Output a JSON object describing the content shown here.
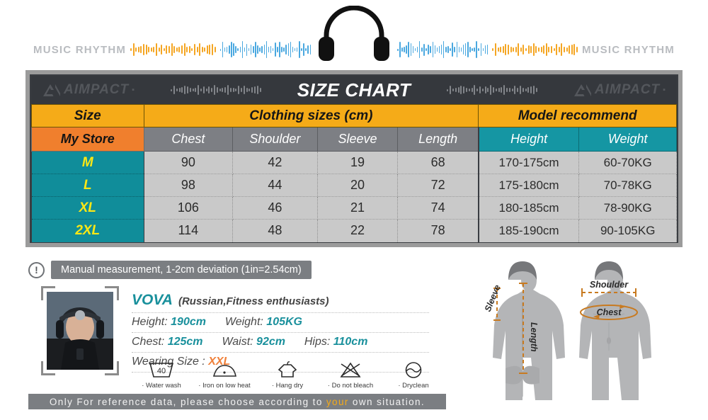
{
  "banner": {
    "left_text": "MUSIC RHYTHM",
    "right_text": "MUSIC RHYTHM",
    "headphone_icon": "headphones-icon",
    "wave_color_orange": "#f5a623",
    "wave_color_blue": "#4aa8e0"
  },
  "chart": {
    "title": "SIZE CHART",
    "brand_left": "AIMPACT",
    "brand_right": "AIMPACT",
    "brand_mark": "aimpact-logo-icon",
    "colors": {
      "gold": "#f5ab18",
      "orange": "#f07f2d",
      "teal": "#1596a3",
      "dark": "#35383d",
      "gray_value": "#c9c9c9",
      "size_label_yellow": "#ffe814"
    }
  },
  "chart_data": {
    "type": "table",
    "title": "SIZE CHART",
    "group_headers": [
      {
        "label": "Size",
        "span": 1
      },
      {
        "label": "Clothing sizes  (cm)",
        "span": 4
      },
      {
        "label": "Model recommend",
        "span": 2
      }
    ],
    "columns": [
      "My Store",
      "Chest",
      "Shoulder",
      "Sleeve",
      "Length",
      "Height",
      "Weight"
    ],
    "rows": [
      {
        "size": "M",
        "chest": "90",
        "shoulder": "42",
        "sleeve": "19",
        "length": "68",
        "height": "170-175cm",
        "weight": "60-70KG"
      },
      {
        "size": "L",
        "chest": "98",
        "shoulder": "44",
        "sleeve": "20",
        "length": "72",
        "height": "175-180cm",
        "weight": "70-78KG"
      },
      {
        "size": "XL",
        "chest": "106",
        "shoulder": "46",
        "sleeve": "21",
        "length": "74",
        "height": "180-185cm",
        "weight": "78-90KG"
      },
      {
        "size": "2XL",
        "chest": "114",
        "shoulder": "48",
        "sleeve": "22",
        "length": "78",
        "height": "185-190cm",
        "weight": "90-105KG"
      }
    ]
  },
  "note": {
    "icon": "exclamation-icon",
    "text": "Manual measurement, 1-2cm deviation (1in=2.54cm)"
  },
  "model": {
    "photo_alt": "model-photo",
    "name": "VOVA",
    "description": "(Russian,Fitness enthusiasts)",
    "height_label": "Height:",
    "height_value": "190cm",
    "weight_label": "Weight:",
    "weight_value": "105KG",
    "chest_label": "Chest:",
    "chest_value": "125cm",
    "waist_label": "Waist:",
    "waist_value": "92cm",
    "hips_label": "Hips:",
    "hips_value": "110cm",
    "wearing_label": "Wearing Size :",
    "wearing_value": "XXL"
  },
  "care_instructions": [
    {
      "icon": "water-wash-icon",
      "label": "Water wash",
      "temp": "40"
    },
    {
      "icon": "iron-low-icon",
      "label": "Iron on low heat",
      "temp": ""
    },
    {
      "icon": "hang-dry-icon",
      "label": "Hang dry",
      "temp": ""
    },
    {
      "icon": "no-bleach-icon",
      "label": "Do not bleach",
      "temp": ""
    },
    {
      "icon": "dryclean-icon",
      "label": "Dryclean",
      "temp": ""
    }
  ],
  "footer": {
    "text_before": "Only For reference data, please choose according to ",
    "highlight": "your",
    "text_after": " own situation."
  },
  "diagram": {
    "back_view": {
      "sleeve": "Sleeve",
      "length": "Length"
    },
    "front_view": {
      "shoulder": "Shoulder",
      "chest": "Chest"
    },
    "accent_color": "#c87a20"
  }
}
